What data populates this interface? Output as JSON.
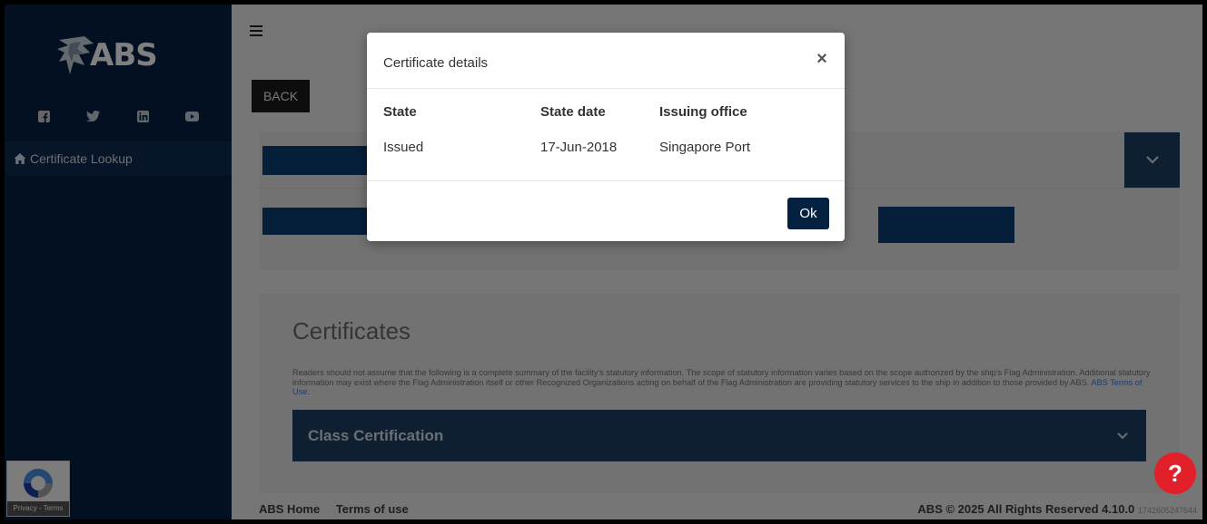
{
  "sidebar": {
    "logo_text": "ABS",
    "social_icons": [
      "facebook-icon",
      "twitter-icon",
      "linkedin-icon",
      "youtube-icon"
    ],
    "nav_item_label": "Certificate Lookup",
    "recaptcha_text": "Privacy - Terms"
  },
  "main": {
    "back_label": "BACK",
    "certificates_title": "Certificates",
    "disclaimer": "Readers should not assume that the following is a complete summary of the facility's statutory information. The scope of statutory information varies based on the scope authorized by the ship's Flag Administration. Additional statutory information may exist where the Flag Administration itself or other Recognized Organizations acting on behalf of the Flag Administration are providing statutory services to the ship in addition to those provided by ABS.",
    "terms_link": "ABS Terms of Use.",
    "class_certification_label": "Class Certification"
  },
  "footer": {
    "home_link": "ABS Home",
    "terms_link": "Terms of use",
    "copyright": "ABS © 2025 All Rights Reserved 4.10.0",
    "build": "1742605247644"
  },
  "help_label": "?",
  "modal": {
    "title": "Certificate details",
    "close": "×",
    "headers": {
      "state": "State",
      "state_date": "State date",
      "issuing_office": "Issuing office"
    },
    "row": {
      "state": "Issued",
      "state_date": "17-Jun-2018",
      "issuing_office": "Singapore Port"
    },
    "ok_label": "Ok"
  },
  "colors": {
    "sidebar": "#052142",
    "accent_blue": "#0a3c75",
    "panel_dark": "#1d3f63",
    "help_red": "#e2202a"
  }
}
